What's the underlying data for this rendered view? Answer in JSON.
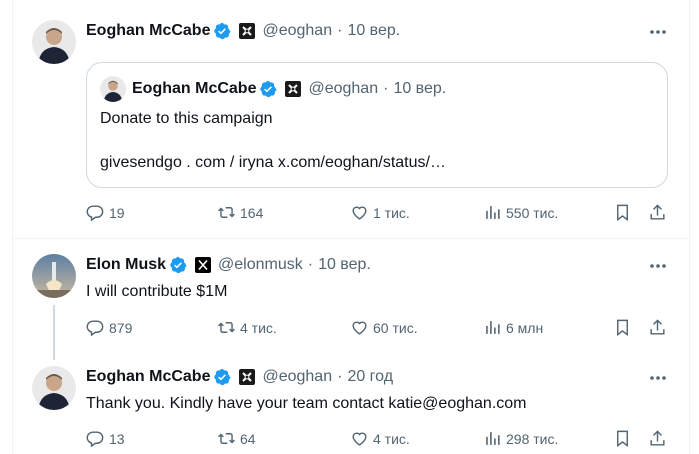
{
  "post1": {
    "name": "Eoghan McCabe",
    "handle": "@eoghan",
    "sep": "·",
    "time": "10 вер.",
    "quote": {
      "name": "Eoghan McCabe",
      "handle": "@eoghan",
      "sep": "·",
      "time": "10 вер.",
      "line1": "Donate to this campaign",
      "line2": "givesendgo . com / iryna x.com/eoghan/status/…"
    },
    "replies": "19",
    "reposts": "164",
    "likes": "1 тис.",
    "views": "550 тис."
  },
  "post2": {
    "name": "Elon Musk",
    "handle": "@elonmusk",
    "sep": "·",
    "time": "10 вер.",
    "text": "I will contribute $1M",
    "replies": "879",
    "reposts": "4 тис.",
    "likes": "60 тис.",
    "views": "6 млн"
  },
  "post3": {
    "name": "Eoghan McCabe",
    "handle": "@eoghan",
    "sep": "·",
    "time": "20 год",
    "text": "Thank you. Kindly have your team contact katie@eoghan.com",
    "replies": "13",
    "reposts": "64",
    "likes": "4 тис.",
    "views": "298 тис."
  },
  "colors": {
    "text": "#0f1419",
    "muted": "#536471",
    "verified": "#1d9bf0",
    "border": "#cfd9de"
  }
}
